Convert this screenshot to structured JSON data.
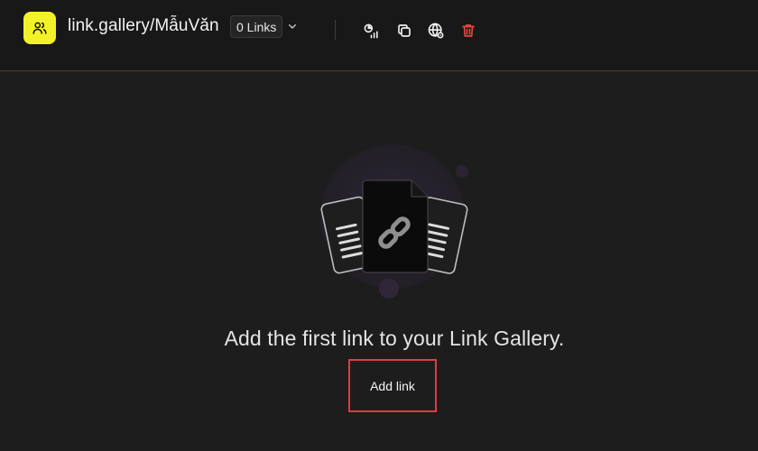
{
  "header": {
    "logo_icon": "users-icon",
    "title": "link.gallery/MẫuVăn",
    "link_count": "0 Links",
    "dropdown_icon": "chevron-down-icon",
    "tools": [
      {
        "name": "analytics-icon"
      },
      {
        "name": "copy-icon"
      },
      {
        "name": "globe-settings-icon"
      },
      {
        "name": "trash-icon"
      }
    ]
  },
  "empty_state": {
    "illustration_icon": "link-icon",
    "message": "Add the first link to your Link Gallery.",
    "add_button_label": "Add link"
  },
  "colors": {
    "background": "#1d1d1d",
    "topbar": "#181818",
    "accent_yellow": "#f3f229",
    "danger_red": "#e43b3b",
    "divider_gold": "#4a4232"
  }
}
